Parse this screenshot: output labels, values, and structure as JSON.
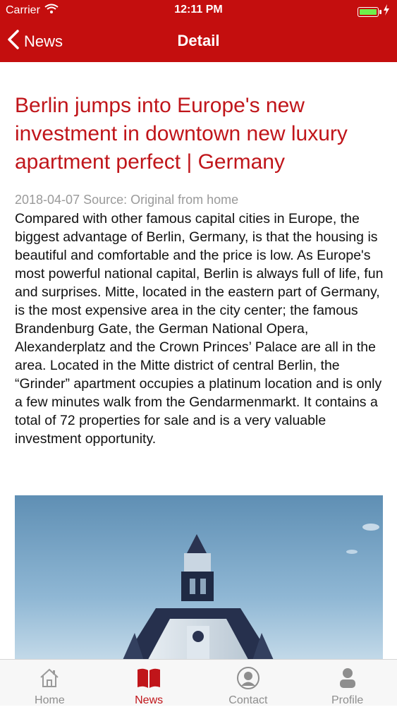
{
  "status_bar": {
    "carrier": "Carrier",
    "time": "12:11 PM",
    "battery_color": "#6ef04a"
  },
  "nav": {
    "back_label": "News",
    "title": "Detail",
    "color": "#c40e0e"
  },
  "article": {
    "title": "Berlin jumps into Europe's new investment in downtown new luxury apartment perfect | Germany",
    "meta": "2018-04-07 Source: Original from home",
    "body": "Compared with other famous capital cities in Europe, the biggest advantage of Berlin, Germany, is that the housing is beautiful and comfortable and the price is low. As Europe's most powerful national capital, Berlin is always full of life, fun and surprises. Mitte, located in the eastern part of Germany, is the most expensive area in the city center; the famous Brandenburg Gate, the German National Opera, Alexanderplatz and the Crown Princes’ Palace are all in the area. Located in the Mitte district of central Berlin, the “Grinder” apartment occupies a platinum location and is only a few minutes walk from the Gendarmenmarkt. It contains a total of 72 properties for sale and is a very valuable investment opportunity.",
    "title_color": "#c0151a"
  },
  "tabs": [
    {
      "label": "Home",
      "icon": "home-icon"
    },
    {
      "label": "News",
      "icon": "book-icon",
      "active": true
    },
    {
      "label": "Contact",
      "icon": "contact-icon"
    },
    {
      "label": "Profile",
      "icon": "profile-icon"
    }
  ]
}
